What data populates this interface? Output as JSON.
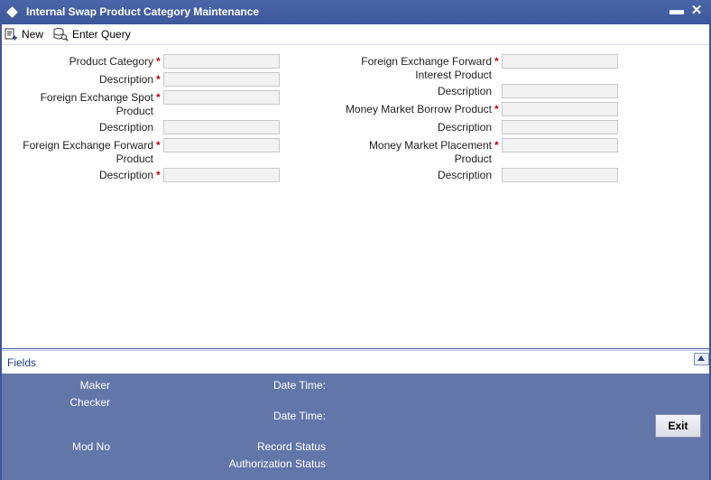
{
  "window": {
    "title": "Internal Swap Product Category Maintenance",
    "minimize_label": "▬",
    "close_label": "✕"
  },
  "toolbar": {
    "new_label": "New",
    "enter_query_label": "Enter Query"
  },
  "form": {
    "required_mark": "*",
    "left": {
      "product_category": "Product Category",
      "description_1": "Description",
      "fx_spot_line1": "Foreign Exchange Spot",
      "fx_spot_line2": "Product",
      "description_2": "Description",
      "fx_forward_line1": "Foreign Exchange Forward",
      "fx_forward_line2": "Product",
      "description_3": "Description"
    },
    "right": {
      "fx_fwd_interest_line1": "Foreign Exchange Forward",
      "fx_fwd_interest_line2": "Interest Product",
      "description_1": "Description",
      "mm_borrow": "Money Market Borrow Product",
      "description_2": "Description",
      "mm_placement_line1": "Money Market Placement",
      "mm_placement_line2": "Product",
      "description_3": "Description"
    }
  },
  "fields_section": {
    "label": "Fields"
  },
  "footer": {
    "maker": "Maker",
    "checker": "Checker",
    "mod_no": "Mod No",
    "date_time_1": "Date Time:",
    "date_time_2": "Date Time:",
    "record_status": "Record Status",
    "authorization_status": "Authorization Status",
    "exit_label": "Exit"
  },
  "colors": {
    "title_bar": "#3c579a",
    "footer": "#6276aa",
    "required": "#cc0000",
    "link": "#1c3e8c"
  },
  "icons": [
    "diamond-icon",
    "new-document-icon",
    "enter-query-icon",
    "collapse-up-icon"
  ]
}
